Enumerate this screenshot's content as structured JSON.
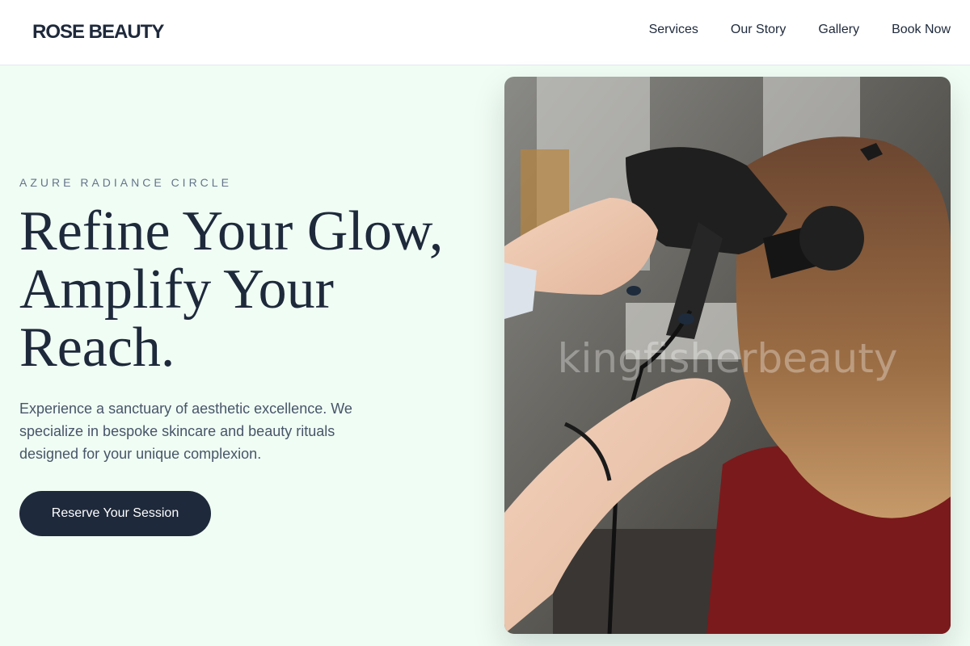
{
  "brand": {
    "logo": "ROSE BEAUTY"
  },
  "nav": {
    "items": [
      {
        "label": "Services"
      },
      {
        "label": "Our Story"
      },
      {
        "label": "Gallery"
      },
      {
        "label": "Book Now"
      }
    ]
  },
  "hero": {
    "eyebrow": "AZURE RADIANCE CIRCLE",
    "headline_line1": "Refine Your Glow,",
    "headline_line2": "Amplify Your",
    "headline_line3": "Reach.",
    "subtext": "Experience a sanctuary of aesthetic excellence. We specialize in bespoke skincare and beauty rituals designed for your unique complexion.",
    "cta_label": "Reserve Your Session"
  },
  "photo": {
    "watermark": "kingfisherbeauty",
    "subject": "stylist-blow-drying-hair"
  },
  "colors": {
    "background": "#f0fdf4",
    "navbar": "#ffffff",
    "primary_text": "#1e293b",
    "muted_text": "#64748b",
    "button": "#1e293b"
  }
}
